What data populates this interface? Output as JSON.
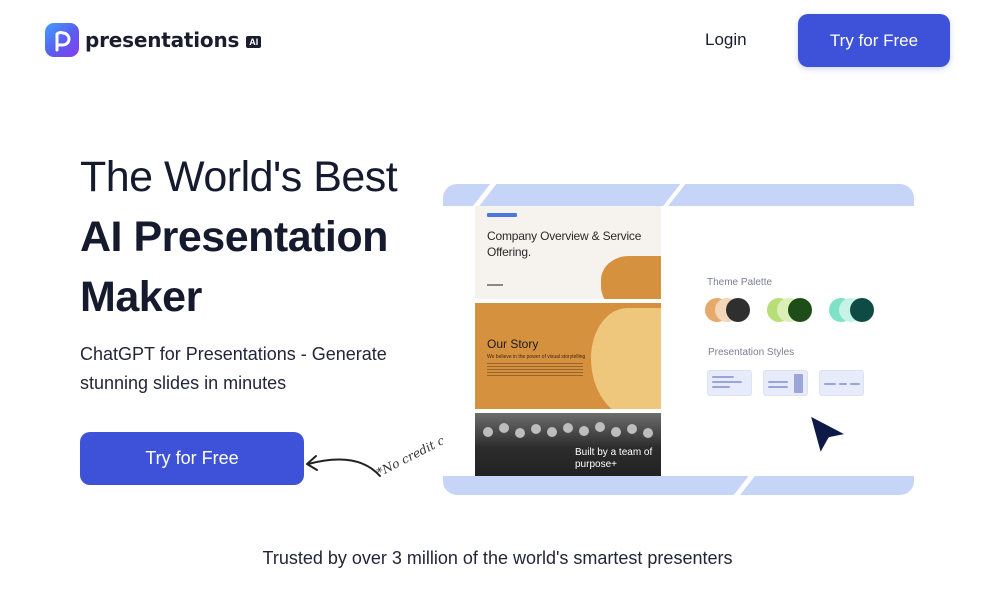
{
  "brand": {
    "name": "presentations",
    "badge": "AI",
    "accent": "#3d52d9"
  },
  "nav": {
    "login_label": "Login",
    "cta_label": "Try for Free"
  },
  "hero": {
    "title_line1": "The World's Best",
    "title_line2": "AI Presentation",
    "title_line3": "Maker",
    "subtitle": "ChatGPT for Presentations - Generate stunning slides in minutes",
    "cta_label": "Try for Free",
    "note": "*No credit card required"
  },
  "mockup": {
    "slides": [
      {
        "title": "Company Overview & Service Offering."
      },
      {
        "title": "Our Story",
        "subtitle": "We believe in the power of visual storytelling"
      },
      {
        "title": "Built by a team of purpose+"
      }
    ],
    "theme_palette_label": "Theme Palette",
    "presentation_styles_label": "Presentation Styles",
    "palettes": [
      {
        "colors": [
          "#e7a96a",
          "#f1d6b9",
          "#2f2f2f"
        ]
      },
      {
        "colors": [
          "#b6df77",
          "#dcefb7",
          "#1e4d19"
        ]
      },
      {
        "colors": [
          "#7fe1c7",
          "#c7f3e6",
          "#0f4b45"
        ]
      }
    ]
  },
  "trusted_text": "Trusted by over 3 million of the world's smartest presenters"
}
